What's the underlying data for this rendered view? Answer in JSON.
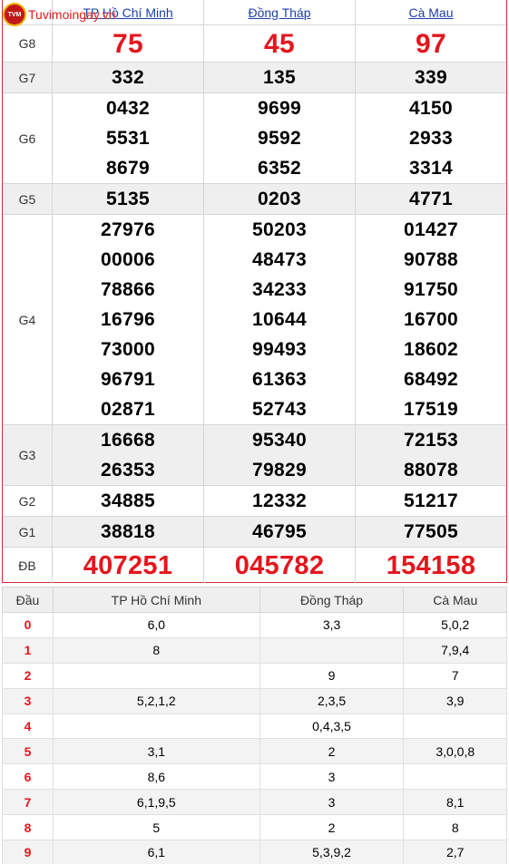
{
  "logo": {
    "badge": "TVM",
    "text": "Tuvimoingay.vn"
  },
  "provinces": [
    "TP Hồ Chí Minh",
    "Đồng Tháp",
    "Cà Mau"
  ],
  "prizes": [
    {
      "label": "G8",
      "values": [
        [
          "75"
        ],
        [
          "45"
        ],
        [
          "97"
        ]
      ]
    },
    {
      "label": "G7",
      "values": [
        [
          "332"
        ],
        [
          "135"
        ],
        [
          "339"
        ]
      ]
    },
    {
      "label": "G6",
      "values": [
        [
          "0432",
          "5531",
          "8679"
        ],
        [
          "9699",
          "9592",
          "6352"
        ],
        [
          "4150",
          "2933",
          "3314"
        ]
      ]
    },
    {
      "label": "G5",
      "values": [
        [
          "5135"
        ],
        [
          "0203"
        ],
        [
          "4771"
        ]
      ]
    },
    {
      "label": "G4",
      "values": [
        [
          "27976",
          "00006",
          "78866",
          "16796",
          "73000",
          "96791",
          "02871"
        ],
        [
          "50203",
          "48473",
          "34233",
          "10644",
          "99493",
          "61363",
          "52743"
        ],
        [
          "01427",
          "90788",
          "91750",
          "16700",
          "18602",
          "68492",
          "17519"
        ]
      ]
    },
    {
      "label": "G3",
      "values": [
        [
          "16668",
          "26353"
        ],
        [
          "95340",
          "79829"
        ],
        [
          "72153",
          "88078"
        ]
      ]
    },
    {
      "label": "G2",
      "values": [
        [
          "34885"
        ],
        [
          "12332"
        ],
        [
          "51217"
        ]
      ]
    },
    {
      "label": "G1",
      "values": [
        [
          "38818"
        ],
        [
          "46795"
        ],
        [
          "77505"
        ]
      ]
    },
    {
      "label": "ĐB",
      "values": [
        [
          "407251"
        ],
        [
          "045782"
        ],
        [
          "154158"
        ]
      ]
    }
  ],
  "loto": {
    "head_label": "Đầu",
    "columns": [
      "TP Hồ Chí Minh",
      "Đồng Tháp",
      "Cà Mau"
    ],
    "rows": [
      {
        "head": "0",
        "values": [
          "6,0",
          "3,3",
          "5,0,2"
        ]
      },
      {
        "head": "1",
        "values": [
          "8",
          "",
          "7,9,4"
        ]
      },
      {
        "head": "2",
        "values": [
          "",
          "9",
          "7"
        ]
      },
      {
        "head": "3",
        "values": [
          "5,2,1,2",
          "2,3,5",
          "3,9"
        ]
      },
      {
        "head": "4",
        "values": [
          "",
          "0,4,3,5",
          ""
        ]
      },
      {
        "head": "5",
        "values": [
          "3,1",
          "2",
          "3,0,0,8"
        ]
      },
      {
        "head": "6",
        "values": [
          "8,6",
          "3",
          ""
        ]
      },
      {
        "head": "7",
        "values": [
          "6,1,9,5",
          "3",
          "8,1"
        ]
      },
      {
        "head": "8",
        "values": [
          "5",
          "2",
          "8"
        ]
      },
      {
        "head": "9",
        "values": [
          "6,1",
          "5,3,9,2",
          "2,7"
        ]
      }
    ]
  },
  "colors": {
    "accent_red": "#e4161d",
    "link_blue": "#1d3fa8",
    "border_red": "#d12f2f"
  }
}
